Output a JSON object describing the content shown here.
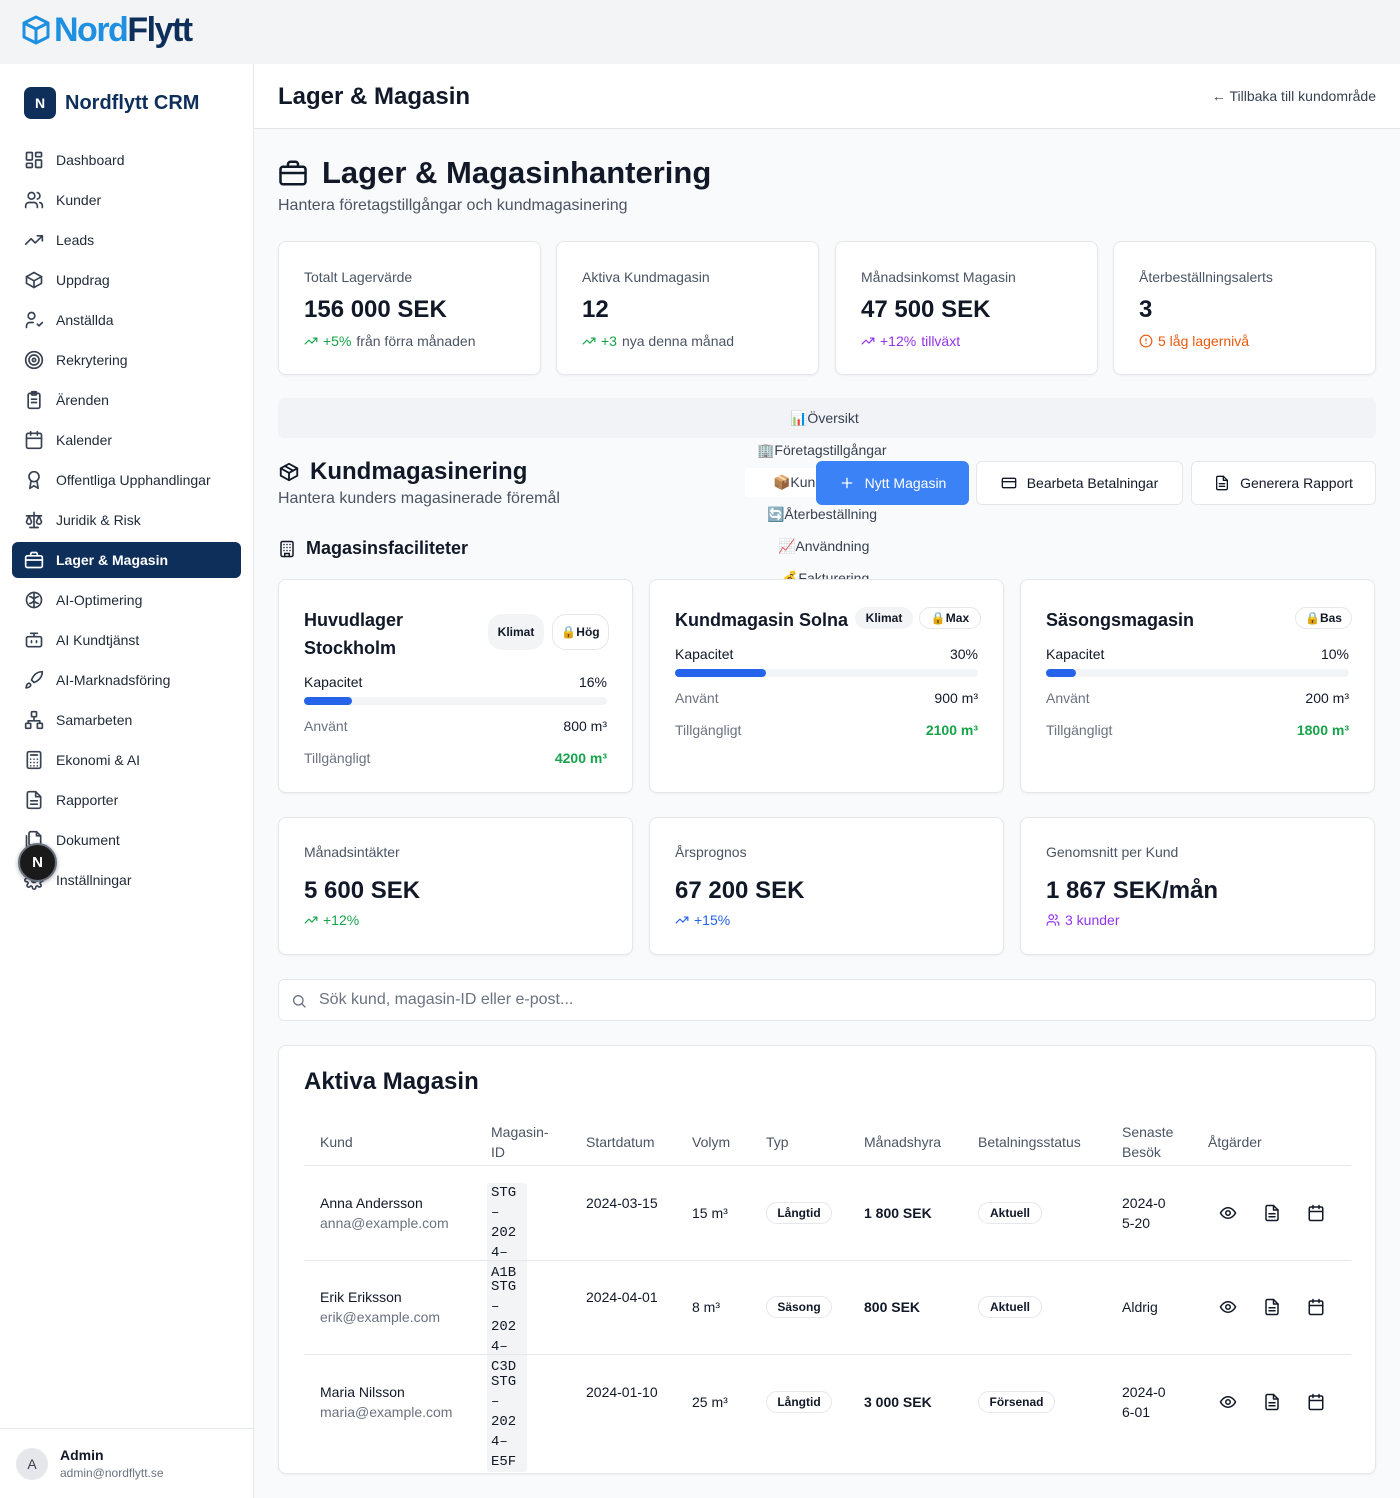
{
  "logo": {
    "word_a": "Nord",
    "word_b": "Flytt"
  },
  "brand": {
    "badge": "N",
    "name": "Nordflytt CRM"
  },
  "nav": [
    {
      "label": "Dashboard",
      "icon": "dashboard-grid-icon"
    },
    {
      "label": "Kunder",
      "icon": "users-icon"
    },
    {
      "label": "Leads",
      "icon": "trending-up-icon"
    },
    {
      "label": "Uppdrag",
      "icon": "package-icon"
    },
    {
      "label": "Anställda",
      "icon": "user-check-icon"
    },
    {
      "label": "Rekrytering",
      "icon": "target-icon"
    },
    {
      "label": "Ärenden",
      "icon": "clipboard-icon"
    },
    {
      "label": "Kalender",
      "icon": "calendar-icon"
    },
    {
      "label": "Offentliga Upphandlingar",
      "icon": "award-icon"
    },
    {
      "label": "Juridik & Risk",
      "icon": "scale-icon"
    },
    {
      "label": "Lager & Magasin",
      "icon": "archive-icon",
      "active": true
    },
    {
      "label": "AI-Optimering",
      "icon": "brain-icon"
    },
    {
      "label": "AI Kundtjänst",
      "icon": "bot-icon"
    },
    {
      "label": "AI-Marknadsföring",
      "icon": "rocket-icon"
    },
    {
      "label": "Samarbeten",
      "icon": "network-icon"
    },
    {
      "label": "Ekonomi & AI",
      "icon": "calculator-icon"
    },
    {
      "label": "Rapporter",
      "icon": "file-text-icon"
    },
    {
      "label": "Dokument",
      "icon": "files-icon"
    },
    {
      "label": "Inställningar",
      "icon": "settings-icon"
    }
  ],
  "user": {
    "initial": "A",
    "name": "Admin",
    "email": "admin@nordflytt.se"
  },
  "overlay_badge": "N",
  "header": {
    "title": "Lager & Magasin",
    "back": "← Tillbaka till kundområde"
  },
  "page": {
    "title": "Lager & Magasinhantering",
    "subtitle": "Hantera företagstillgångar och kundmagasinering"
  },
  "stats": [
    {
      "label": "Totalt Lagervärde",
      "value": "156 000 SEK",
      "delta": "+5%",
      "note": "från förra månaden",
      "color": "#16a34a"
    },
    {
      "label": "Aktiva Kundmagasin",
      "value": "12",
      "delta": "+3",
      "note": "nya denna månad",
      "color": "#16a34a"
    },
    {
      "label": "Månadsinkomst Magasin",
      "value": "47 500 SEK",
      "delta": "+12%",
      "note": "tillväxt",
      "color": "#9333ea"
    },
    {
      "label": "Återbeställningsalerts",
      "value": "3",
      "delta": "5 låg lagernivå",
      "note": "",
      "color": "#ea580c"
    }
  ],
  "tabs": [
    "📊Översikt",
    "🏢Företagstillgångar",
    "📦Kundmagasin",
    "🔄Återbeställning",
    "📈Användning",
    "💰Fakturering"
  ],
  "section": {
    "title": "Kundmagasinering",
    "subtitle": "Hantera kunders magasinerade föremål"
  },
  "buttons": {
    "new": "Nytt Magasin",
    "payments": "Bearbeta Betalningar",
    "report": "Generera Rapport"
  },
  "facilities_title": "Magasinsfaciliteter",
  "labels": {
    "capacity": "Kapacitet",
    "used": "Använt",
    "available": "Tillgängligt"
  },
  "facilities": [
    {
      "name": "Huvudlager Stockholm",
      "chip1": "Klimat",
      "chip2": "🔒Hög",
      "capacity_pct": 16,
      "capacity": "16%",
      "used": "800 m³",
      "available": "4200 m³"
    },
    {
      "name": "Kundmagasin Solna",
      "chip1": "Klimat",
      "chip2": "🔒Max",
      "capacity_pct": 30,
      "capacity": "30%",
      "used": "900 m³",
      "available": "2100 m³"
    },
    {
      "name": "Säsongsmagasin",
      "chip1": "",
      "chip2": "🔒Bas",
      "capacity_pct": 10,
      "capacity": "10%",
      "used": "200 m³",
      "available": "1800 m³"
    }
  ],
  "revenue": [
    {
      "label": "Månadsintäkter",
      "value": "5 600 SEK",
      "delta": "+12%",
      "color": "#16a34a"
    },
    {
      "label": "Årsprognos",
      "value": "67 200 SEK",
      "delta": "+15%",
      "color": "#2563eb"
    },
    {
      "label": "Genomsnitt per Kund",
      "value": "1 867 SEK/mån",
      "delta": "3 kunder",
      "color": "#9333ea"
    }
  ],
  "search": {
    "placeholder": "Sök kund, magasin-ID eller e-post..."
  },
  "table": {
    "title": "Aktiva Magasin",
    "headers": [
      "Kund",
      "Magasin-ID",
      "Startdatum",
      "Volym",
      "Typ",
      "Månadshyra",
      "Betalningsstatus",
      "Senaste Besök",
      "Åtgärder"
    ],
    "rows": [
      {
        "name": "Anna Andersson",
        "email": "anna@example.com",
        "id": "STG-2024-A1B",
        "start": "2024-03-15",
        "volume": "15 m³",
        "type": "Långtid",
        "rent": "1 800 SEK",
        "status": "Aktuell",
        "visit": "2024-05-20"
      },
      {
        "name": "Erik Eriksson",
        "email": "erik@example.com",
        "id": "STG-2024-C3D",
        "start": "2024-04-01",
        "volume": "8 m³",
        "type": "Säsong",
        "rent": "800 SEK",
        "status": "Aktuell",
        "visit": "Aldrig"
      },
      {
        "name": "Maria Nilsson",
        "email": "maria@example.com",
        "id": "STG-2024-E5F",
        "start": "2024-01-10",
        "volume": "25 m³",
        "type": "Långtid",
        "rent": "3 000 SEK",
        "status": "Försenad",
        "visit": "2024-06-01"
      }
    ]
  },
  "colors": {
    "brand": "#0f2f5b",
    "accent": "#3b82f6",
    "logo_dark": "#0f2f5b",
    "logo_light": "#1f8fe0",
    "available": "#16a34a"
  }
}
